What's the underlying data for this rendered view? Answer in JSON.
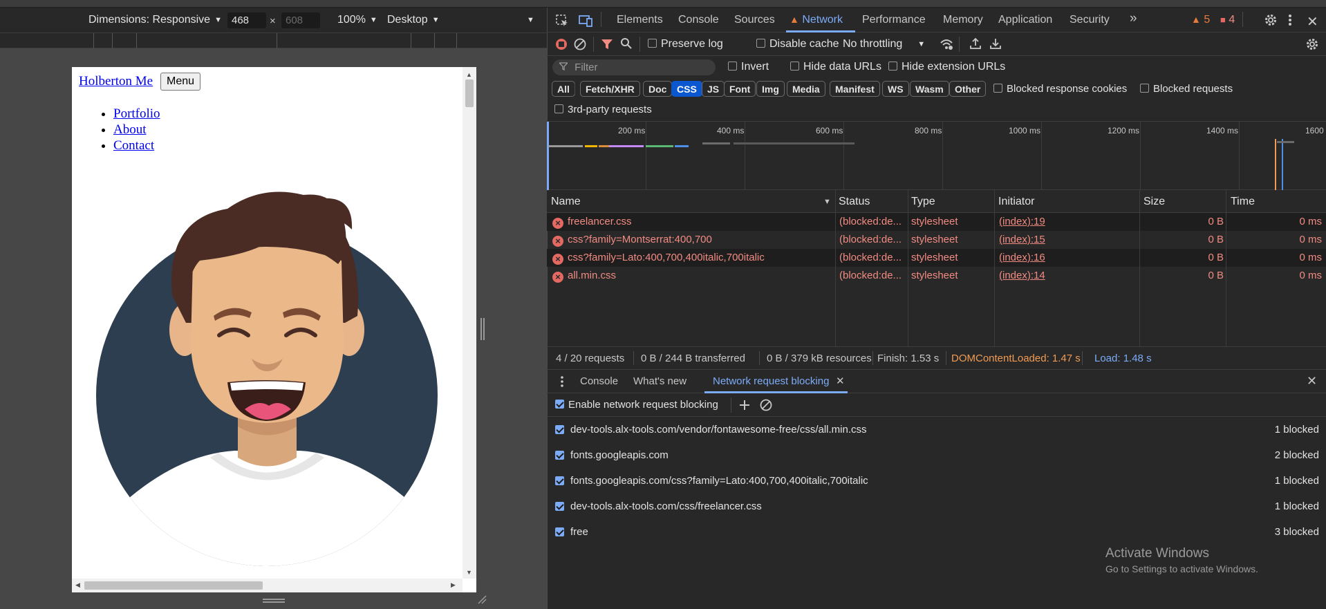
{
  "device_toolbar": {
    "dimensions_label": "Dimensions: Responsive",
    "width_value": "468",
    "height_placeholder": "608",
    "times": "×",
    "zoom": "100%",
    "device_type": "Desktop"
  },
  "page": {
    "brand": "Holberton Me",
    "menu_button": "Menu",
    "nav": [
      "Portfolio",
      "About",
      "Contact"
    ]
  },
  "devtools_tabs": {
    "elements": "Elements",
    "console": "Console",
    "sources": "Sources",
    "network": "Network",
    "performance": "Performance",
    "memory": "Memory",
    "application": "Application",
    "security": "Security",
    "more": "»",
    "warnings_count": "5",
    "errors_count": "4"
  },
  "network_toolbar": {
    "preserve_log": "Preserve log",
    "disable_cache": "Disable cache",
    "throttling": "No throttling"
  },
  "filter_row": {
    "filter_placeholder": "Filter",
    "invert": "Invert",
    "hide_data_urls": "Hide data URLs",
    "hide_extension_urls": "Hide extension URLs"
  },
  "type_filters": [
    "All",
    "Fetch/XHR",
    "Doc",
    "CSS",
    "JS",
    "Font",
    "Img",
    "Media",
    "Manifest",
    "WS",
    "Wasm",
    "Other"
  ],
  "active_type": "CSS",
  "extra_filters": {
    "blocked_response_cookies": "Blocked response cookies",
    "blocked_requests": "Blocked requests",
    "third_party": "3rd-party requests"
  },
  "timeline_ticks": [
    "200 ms",
    "400 ms",
    "600 ms",
    "800 ms",
    "1000 ms",
    "1200 ms",
    "1400 ms",
    "1600"
  ],
  "table": {
    "headers": [
      "Name",
      "Status",
      "Type",
      "Initiator",
      "Size",
      "Time"
    ],
    "rows": [
      {
        "name": "freelancer.css",
        "status": "(blocked:de...",
        "type": "stylesheet",
        "initiator": "(index):19",
        "size": "0 B",
        "time": "0 ms"
      },
      {
        "name": "css?family=Montserrat:400,700",
        "status": "(blocked:de...",
        "type": "stylesheet",
        "initiator": "(index):15",
        "size": "0 B",
        "time": "0 ms"
      },
      {
        "name": "css?family=Lato:400,700,400italic,700italic",
        "status": "(blocked:de...",
        "type": "stylesheet",
        "initiator": "(index):16",
        "size": "0 B",
        "time": "0 ms"
      },
      {
        "name": "all.min.css",
        "status": "(blocked:de...",
        "type": "stylesheet",
        "initiator": "(index):14",
        "size": "0 B",
        "time": "0 ms"
      }
    ]
  },
  "summary": {
    "requests": "4 / 20 requests",
    "transferred": "0 B / 244 B transferred",
    "resources": "0 B / 379 kB resources",
    "finish": "Finish: 1.53 s",
    "dom_content_loaded": "DOMContentLoaded: 1.47 s",
    "load": "Load: 1.48 s"
  },
  "drawer": {
    "tabs": [
      "Console",
      "What's new",
      "Network request blocking"
    ],
    "enable_blocking": "Enable network request blocking",
    "patterns": [
      {
        "pattern": "dev-tools.alx-tools.com/vendor/fontawesome-free/css/all.min.css",
        "count": "1 blocked"
      },
      {
        "pattern": "fonts.googleapis.com",
        "count": "2 blocked"
      },
      {
        "pattern": "fonts.googleapis.com/css?family=Lato:400,700,400italic,700italic",
        "count": "1 blocked"
      },
      {
        "pattern": "dev-tools.alx-tools.com/css/freelancer.css",
        "count": "1 blocked"
      },
      {
        "pattern": "free",
        "count": "3 blocked"
      }
    ]
  },
  "watermark": {
    "title": "Activate Windows",
    "subtitle": "Go to Settings to activate Windows."
  },
  "colors": {
    "accent": "#7cacf8",
    "error": "#f28b82",
    "dcl": "#f29b52",
    "load": "#7cacf8",
    "warning": "#e77b3b"
  }
}
